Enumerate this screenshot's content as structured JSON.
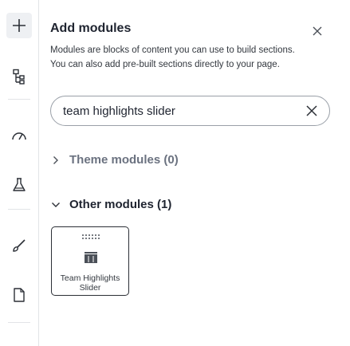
{
  "rail": {
    "items": [
      {
        "icon": "plus-icon",
        "active": true
      },
      {
        "icon": "tree-structure-icon"
      },
      {
        "icon": "gauge-icon"
      },
      {
        "icon": "flask-icon"
      },
      {
        "icon": "brush-icon"
      },
      {
        "icon": "page-icon"
      }
    ]
  },
  "panel": {
    "title": "Add modules",
    "description_line1": "Modules are blocks of content you can use to build sections.",
    "description_line2": "You can also add pre-built sections directly to your page.",
    "search": {
      "value": "team highlights slider",
      "placeholder": ""
    },
    "sections": [
      {
        "label": "Theme modules (0)",
        "expanded": false
      },
      {
        "label": "Other modules (1)",
        "expanded": true
      }
    ],
    "modules": [
      {
        "name_line1": "Team Highlights",
        "name_line2": "Slider"
      }
    ]
  }
}
